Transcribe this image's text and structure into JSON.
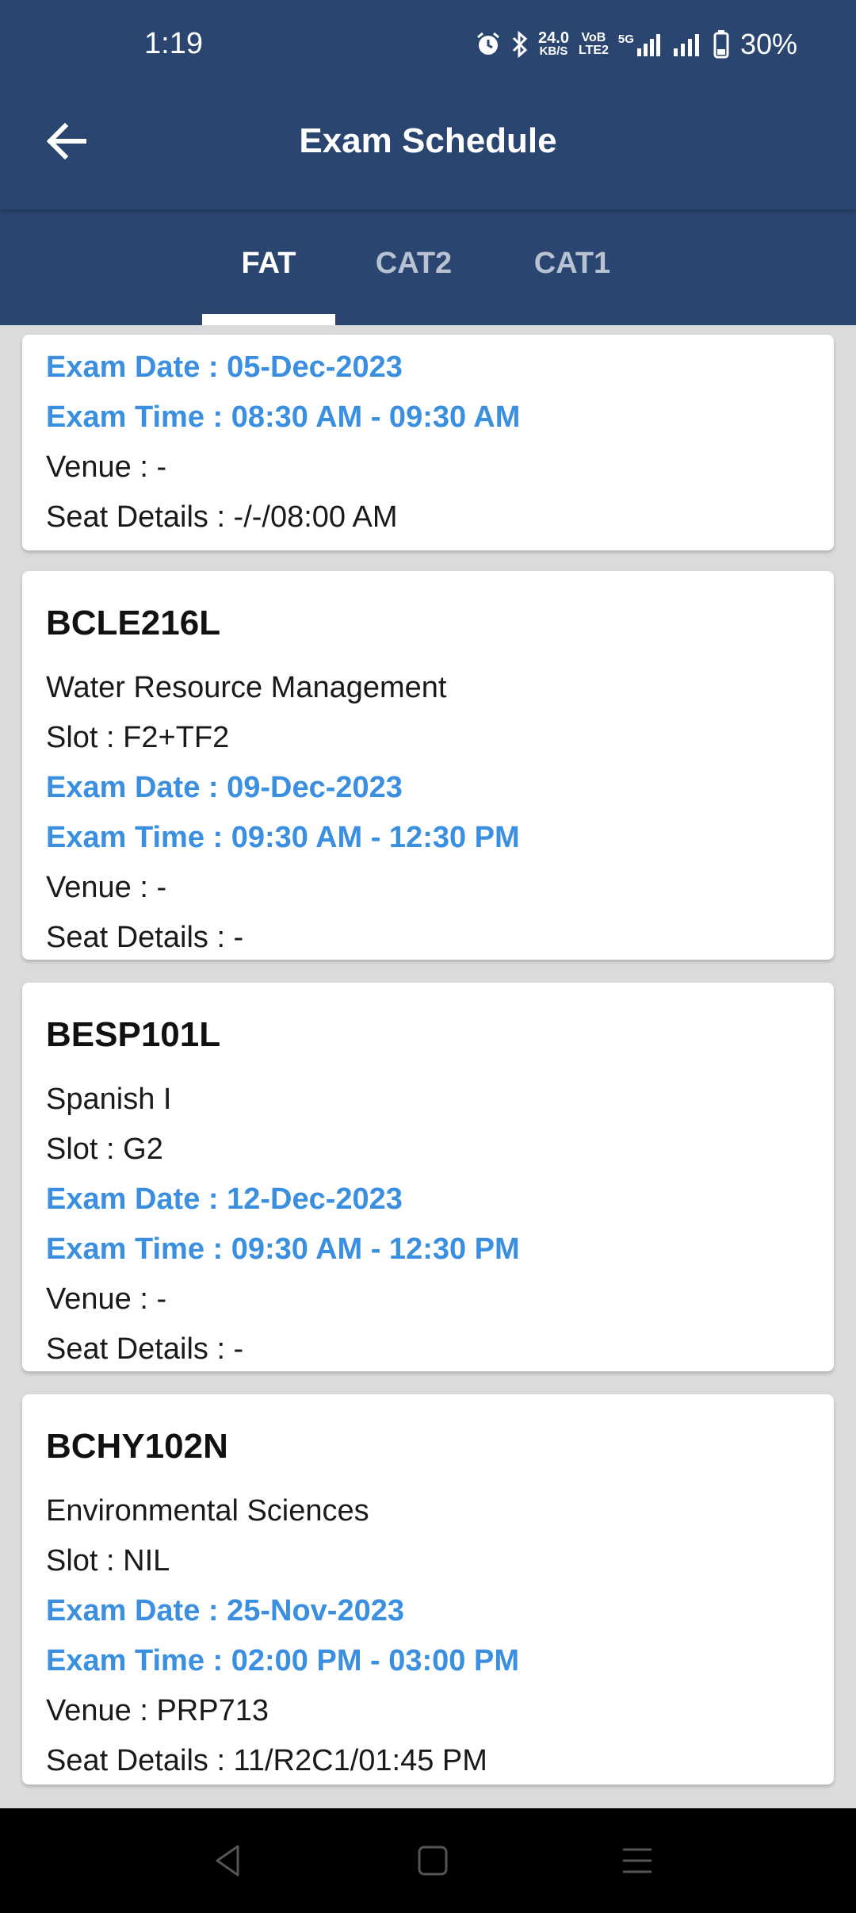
{
  "status_bar": {
    "time": "1:19",
    "net_speed": "24.0",
    "net_unit": "KB/S",
    "volte_top": "VoB",
    "volte_bottom": "LTE2",
    "network": "5G",
    "battery": "30%"
  },
  "header": {
    "title": "Exam Schedule"
  },
  "tabs": [
    {
      "label": "FAT",
      "active": true
    },
    {
      "label": "CAT2",
      "active": false
    },
    {
      "label": "CAT1",
      "active": false
    }
  ],
  "exams": [
    {
      "exam_date": "Exam Date : 05-Dec-2023",
      "exam_time": "Exam Time : 08:30 AM - 09:30 AM",
      "venue": "Venue : -",
      "seat": "Seat Details : -/-/08:00 AM"
    },
    {
      "code": "BCLE216L",
      "name": "Water Resource Management",
      "slot": "Slot : F2+TF2",
      "exam_date": "Exam Date : 09-Dec-2023",
      "exam_time": "Exam Time : 09:30 AM - 12:30 PM",
      "venue": "Venue : -",
      "seat": "Seat Details : -"
    },
    {
      "code": "BESP101L",
      "name": "Spanish I",
      "slot": "Slot : G2",
      "exam_date": "Exam Date : 12-Dec-2023",
      "exam_time": "Exam Time : 09:30 AM - 12:30 PM",
      "venue": "Venue : -",
      "seat": "Seat Details : -"
    },
    {
      "code": "BCHY102N",
      "name": "Environmental Sciences",
      "slot": "Slot : NIL",
      "exam_date": "Exam Date : 25-Nov-2023",
      "exam_time": "Exam Time : 02:00 PM - 03:00 PM",
      "venue": "Venue : PRP713",
      "seat": "Seat Details : 11/R2C1/01:45 PM"
    }
  ],
  "colors": {
    "primary": "#2a4670",
    "accent_text": "#3a8fe0",
    "background": "#dcdada"
  },
  "icons": {
    "back": "arrow-left-icon",
    "nav_back": "triangle-back-icon",
    "nav_home": "square-home-icon",
    "nav_menu": "menu-lines-icon"
  }
}
